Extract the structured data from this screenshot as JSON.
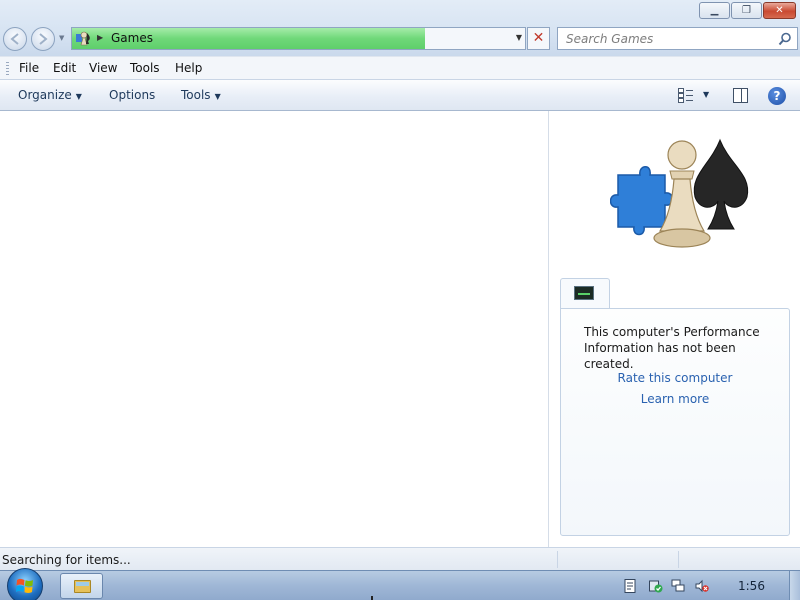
{
  "window": {
    "caption_buttons": {
      "minimize": "minimize-icon",
      "maximize": "restore-icon",
      "close": "close-icon"
    }
  },
  "address_bar": {
    "location": "Games",
    "progress": 0.78,
    "icon": "games-icon"
  },
  "search": {
    "placeholder": "Search Games"
  },
  "menu": {
    "items": [
      "File",
      "Edit",
      "View",
      "Tools",
      "Help"
    ]
  },
  "command_bar": {
    "organize": "Organize",
    "options": "Options",
    "tools": "Tools"
  },
  "details_pane": {
    "performance_message": "This computer's Performance Information has not been created.",
    "rate_link": "Rate this computer",
    "learn_link": "Learn more"
  },
  "status": {
    "text": "Searching for items..."
  },
  "taskbar": {
    "clock": "1:56",
    "tray_icons": [
      "action-center-icon",
      "security-check-icon",
      "network-icon",
      "volume-muted-icon"
    ]
  },
  "colors": {
    "progress": "#6fd879",
    "link": "#2a62b0",
    "taskbar": "#9fb7d6"
  }
}
